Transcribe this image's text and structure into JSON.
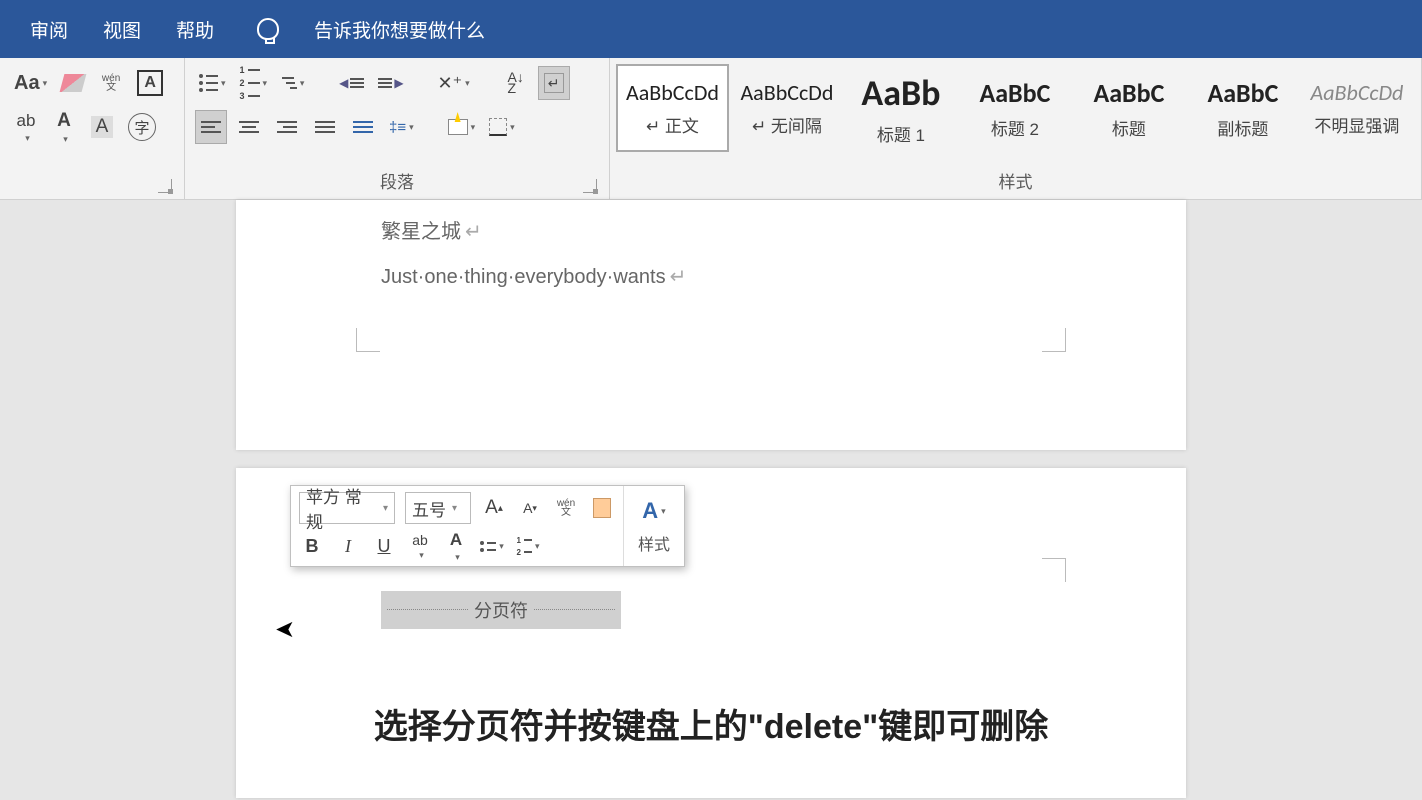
{
  "titlebar": {
    "tabs": [
      "审阅",
      "视图",
      "帮助"
    ],
    "tellme": "告诉我你想要做什么"
  },
  "ribbon": {
    "paragraph_label": "段落",
    "styles_label": "样式",
    "styles": [
      {
        "preview": "AaBbCcDd",
        "name": "↵ 正文",
        "cls": ""
      },
      {
        "preview": "AaBbCcDd",
        "name": "↵ 无间隔",
        "cls": ""
      },
      {
        "preview": "AaBb",
        "name": "标题 1",
        "cls": "big"
      },
      {
        "preview": "AaBbC",
        "name": "标题 2",
        "cls": "bd"
      },
      {
        "preview": "AaBbC",
        "name": "标题",
        "cls": "bd"
      },
      {
        "preview": "AaBbC",
        "name": "副标题",
        "cls": "bd"
      },
      {
        "preview": "AaBbCcDd",
        "name": "不明显强调",
        "cls": "it"
      }
    ]
  },
  "document": {
    "line1": "繁星之城",
    "line2": "Just·one·thing·everybody·wants",
    "page_break": "分页符"
  },
  "mini": {
    "font": "苹方 常规",
    "size": "五号",
    "styles_btn": "样式",
    "bold": "B",
    "italic": "I",
    "underline": "U"
  },
  "caption": "选择分页符并按键盘上的\"delete\"键即可删除"
}
